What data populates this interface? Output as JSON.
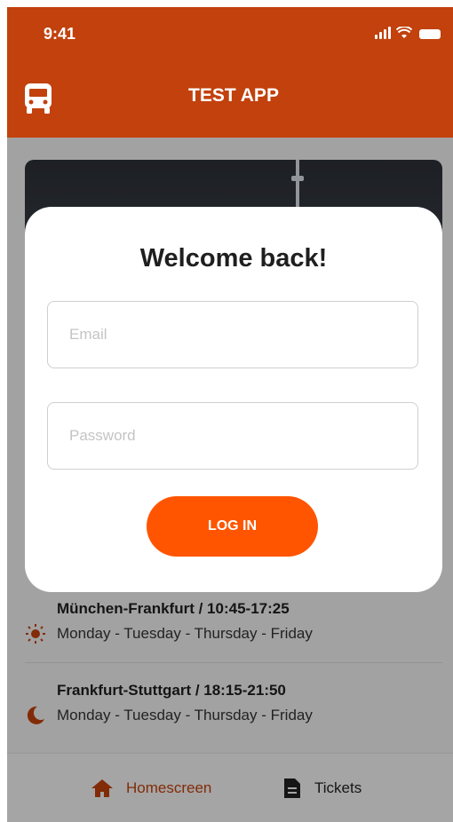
{
  "status_bar": {
    "time": "9:41"
  },
  "header": {
    "title": "TEST APP",
    "icon": "bus-icon"
  },
  "routes": [
    {
      "title": "München-Frankfurt /  10:45-17:25",
      "days": "Monday - Tuesday - Thursday - Friday",
      "icon": "sun-icon"
    },
    {
      "title": "Frankfurt-Stuttgart /  18:15-21:50",
      "days": "Monday - Tuesday - Thursday - Friday",
      "icon": "moon-icon"
    }
  ],
  "modal": {
    "title": "Welcome back!",
    "email_placeholder": "Email",
    "password_placeholder": "Password",
    "login_label": "LOG IN"
  },
  "bottom_nav": {
    "items": [
      {
        "label": "Homescreen",
        "icon": "home-icon",
        "active": true
      },
      {
        "label": "Tickets",
        "icon": "document-icon",
        "active": false
      }
    ]
  },
  "colors": {
    "header": "#c2410c",
    "accent": "#ff5500",
    "active_nav": "#c2410c"
  }
}
